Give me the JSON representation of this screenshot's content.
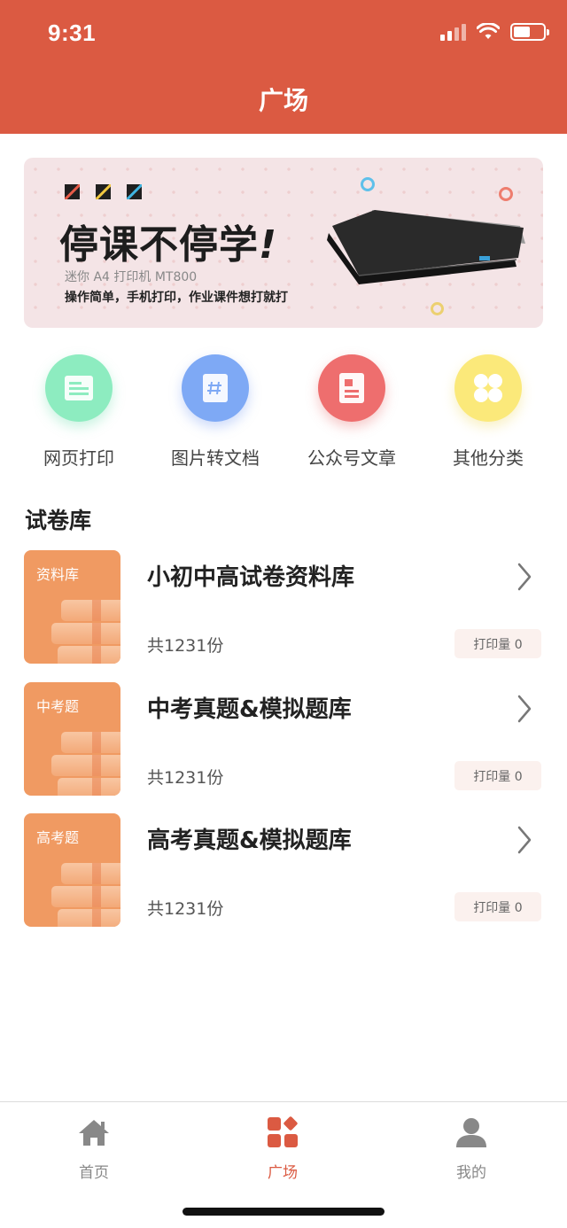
{
  "status_bar": {
    "time": "9:31"
  },
  "header": {
    "title": "广场"
  },
  "banner": {
    "headline": "停课不停学",
    "subtitle": "迷你 A4 打印机 MT800",
    "tagline": "操作简单，手机打印，作业课件想打就打"
  },
  "categories": [
    {
      "label": "网页打印",
      "icon": "webpage-icon",
      "color": "#8DECC0"
    },
    {
      "label": "图片转文档",
      "icon": "image-doc-icon",
      "color": "#7EA9F5"
    },
    {
      "label": "公众号文章",
      "icon": "article-icon",
      "color": "#EE6E6E"
    },
    {
      "label": "其他分类",
      "icon": "grid-icon",
      "color": "#FBE97A"
    }
  ],
  "section": {
    "title": "试卷库"
  },
  "libraries": [
    {
      "thumb_label": "资料库",
      "title": "小初中高试卷资料库",
      "count": "共1231份",
      "badge": "打印量 0"
    },
    {
      "thumb_label": "中考题",
      "title": "中考真题&模拟题库",
      "count": "共1231份",
      "badge": "打印量 0"
    },
    {
      "thumb_label": "高考题",
      "title": "高考真题&模拟题库",
      "count": "共1231份",
      "badge": "打印量 0"
    }
  ],
  "tabbar": {
    "items": [
      {
        "label": "首页",
        "icon": "home-icon",
        "active": false
      },
      {
        "label": "广场",
        "icon": "square-grid-icon",
        "active": true
      },
      {
        "label": "我的",
        "icon": "user-icon",
        "active": false
      }
    ]
  },
  "colors": {
    "accent": "#DB5A42",
    "thumb": "#F09A62",
    "badge_bg": "#FBF1EE"
  }
}
